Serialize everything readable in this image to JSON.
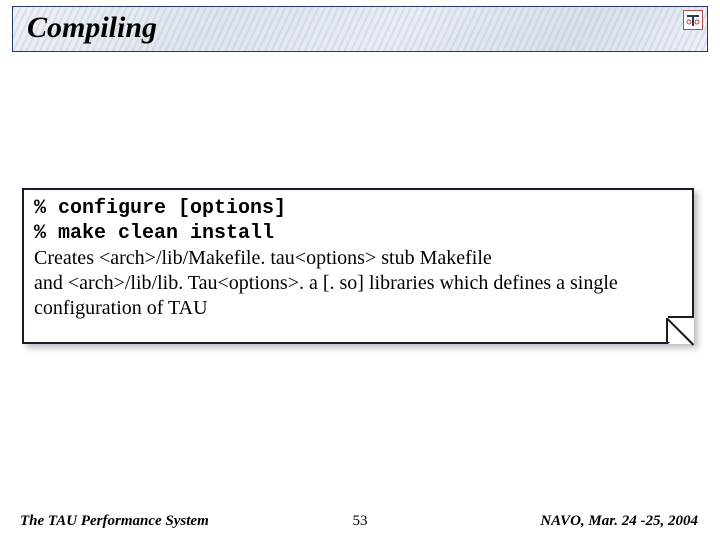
{
  "title": "Compiling",
  "logo_glyph": "τ",
  "commands": {
    "line1": "% configure [options]",
    "line2": "% make clean install"
  },
  "description": {
    "line1": "Creates <arch>/lib/Makefile. tau<options> stub Makefile",
    "line2": "and <arch>/lib/lib. Tau<options>. a [. so] libraries which defines a single",
    "line3": "configuration of TAU"
  },
  "footer": {
    "left": "The TAU Performance System",
    "center": "53",
    "right": "NAVO, Mar. 24 -25, 2004"
  }
}
